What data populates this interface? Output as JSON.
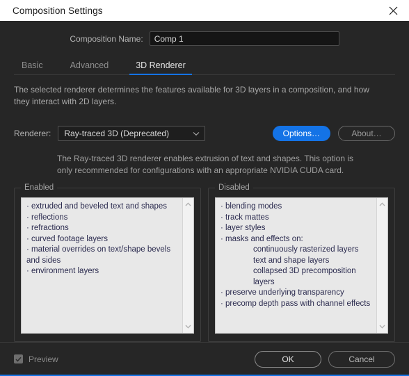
{
  "window": {
    "title": "Composition Settings",
    "close_icon": "close-icon"
  },
  "comp_name": {
    "label": "Composition Name:",
    "value": "Comp 1",
    "placeholder": "Composition Name"
  },
  "tabs": [
    {
      "label": "Basic",
      "active": false
    },
    {
      "label": "Advanced",
      "active": false
    },
    {
      "label": "3D Renderer",
      "active": true
    }
  ],
  "description": "The selected renderer determines the features available for 3D layers in a composition, and how they interact with 2D layers.",
  "renderer": {
    "label": "Renderer:",
    "value": "Ray-traced 3D (Deprecated)",
    "dropdown_icon": "chevron-down-icon",
    "options_button": "Options…",
    "about_button": "About…"
  },
  "renderer_info": "The Ray-traced 3D renderer enables extrusion of text and shapes. This option is only recommended for configurations with an appropriate NVIDIA CUDA card.",
  "enabled_group": {
    "title": "Enabled",
    "items": [
      {
        "text": "· extruded and beveled text and shapes",
        "indented": false
      },
      {
        "text": "· reflections",
        "indented": false
      },
      {
        "text": "· refractions",
        "indented": false
      },
      {
        "text": "· curved footage layers",
        "indented": false
      },
      {
        "text": "· material overrides on text/shape bevels and sides",
        "indented": false
      },
      {
        "text": "· environment layers",
        "indented": false
      }
    ],
    "scroll_up_icon": "chevron-up-icon",
    "scroll_down_icon": "chevron-down-icon"
  },
  "disabled_group": {
    "title": "Disabled",
    "items": [
      {
        "text": "· blending modes",
        "indented": false
      },
      {
        "text": "· track mattes",
        "indented": false
      },
      {
        "text": "· layer styles",
        "indented": false
      },
      {
        "text": "· masks and effects on:",
        "indented": false
      },
      {
        "text": "continuously rasterized layers",
        "indented": true
      },
      {
        "text": "text and shape layers",
        "indented": true
      },
      {
        "text": "collapsed 3D precomposition layers",
        "indented": true
      },
      {
        "text": "· preserve underlying transparency",
        "indented": false
      },
      {
        "text": "· precomp depth pass with channel effects",
        "indented": false
      }
    ],
    "scroll_up_icon": "chevron-up-icon",
    "scroll_down_icon": "chevron-down-icon"
  },
  "footer": {
    "preview_label": "Preview",
    "preview_checked": true,
    "ok_button": "OK",
    "cancel_button": "Cancel"
  },
  "colors": {
    "accent": "#1473e6",
    "dialog_bg": "#262626",
    "titlebar_bg": "#ffffff",
    "list_bg": "#e8e8e8",
    "list_text": "#2b2b4f"
  }
}
